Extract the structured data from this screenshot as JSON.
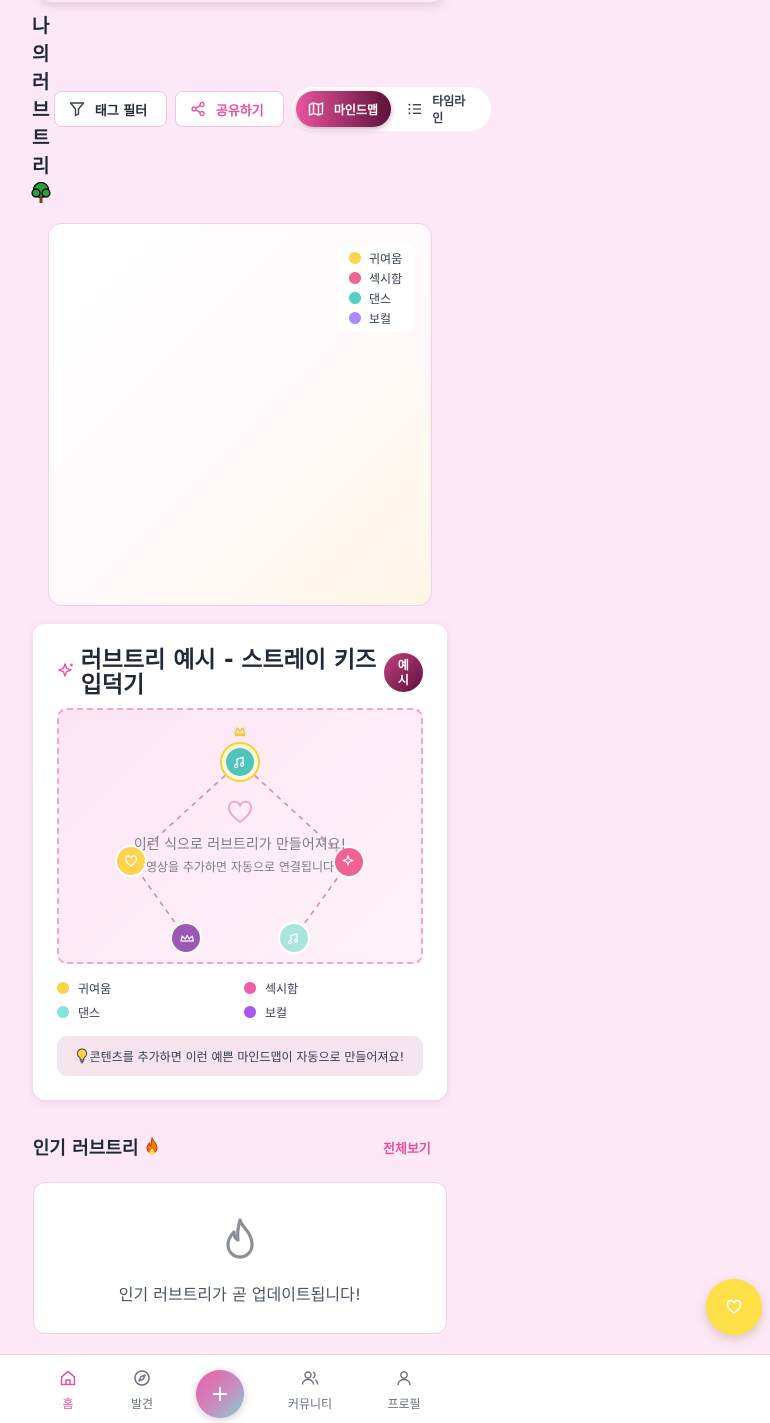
{
  "header": {
    "title": "나의러브트리"
  },
  "toolbar": {
    "tag_filter": "태그 필터",
    "share": "공유하기",
    "view_mindmap": "마인드맵",
    "view_timeline": "타임라인"
  },
  "mindmap": {
    "legend": [
      {
        "label": "귀여움",
        "color": "#fcd34d"
      },
      {
        "label": "섹시함",
        "color": "#f06292"
      },
      {
        "label": "댄스",
        "color": "#4fd1c5"
      },
      {
        "label": "보컬",
        "color": "#a78bfa"
      }
    ]
  },
  "example": {
    "title": "러브트리 예시 - 스트레이 키즈 입덕기",
    "badge": "예시",
    "message": "이런 식으로 러브트리가 만들어져요!",
    "sub_message": "영상을 추가하면 자동으로 연결됩니다",
    "legend": [
      {
        "label": "귀여움",
        "color": "#fcd34d"
      },
      {
        "label": "섹시함",
        "color": "#ec5fa6"
      },
      {
        "label": "댄스",
        "color": "#81e6d9"
      },
      {
        "label": "보컬",
        "color": "#a855f7"
      }
    ],
    "tip": "콘텐츠를 추가하면 이런 예쁜 마인드맵이 자동으로 만들어져요!"
  },
  "popular": {
    "title": "인기 러브트리",
    "view_all": "전체보기",
    "empty": "인기 러브트리가 곧 업데이트됩니다!"
  },
  "nav": {
    "home": "홈",
    "discover": "발견",
    "add": "+",
    "community": "커뮤니티",
    "profile": "프로필"
  },
  "colors": {
    "accent": "#e9519c",
    "accent_dark": "#5e1139",
    "background": "#fde8f8",
    "fab": "#fde047"
  }
}
